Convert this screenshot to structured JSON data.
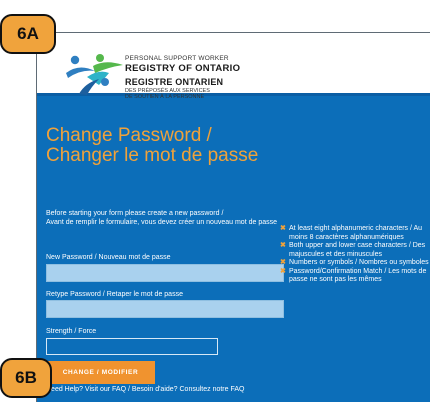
{
  "badges": {
    "a": "6A",
    "b": "6B"
  },
  "org": {
    "en_small": "PERSONAL SUPPORT WORKER",
    "en_big": "REGISTRY OF ONTARIO",
    "fr_big": "REGISTRE ONTARIEN",
    "fr_small": "DES PRÉPOSÉS AUX SERVICES DE SOUTIEN À LA PERSONNE"
  },
  "page": {
    "title": "Change Password / Changer le mot de passe",
    "intro_en": "Before starting your form please create a new password /",
    "intro_fr": "Avant de remplir le formulaire, vous devez créer un nouveau mot de passe"
  },
  "form": {
    "new_password_label": "New Password / Nouveau mot de passe",
    "retype_password_label": "Retype Password / Retaper le mot de passe",
    "strength_label": "Strength / Force",
    "submit_label": "CHANGE / MODIFIER"
  },
  "requirements": [
    "At least eight alphanumeric characters / Au moins 8 caractères alphanumériques",
    "Both upper and lower case characters / Des majuscules et des minuscules",
    "Numbers or symbols / Nombres ou symboles",
    "Password/Confirmation Match / Les mots de passe ne sont pas les mêmes"
  ],
  "help": "Need Help? Visit our FAQ / Besoin d'aide? Consultez notre FAQ",
  "colors": {
    "accent": "#f0a23a",
    "background": "#0c6eb9",
    "input": "#a9d1ee",
    "button": "#f0932f"
  }
}
